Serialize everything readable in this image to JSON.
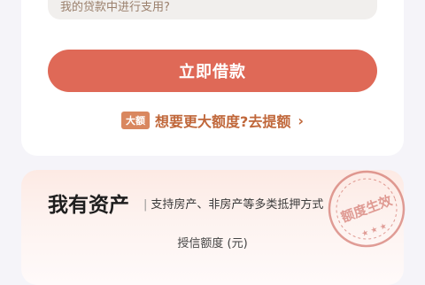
{
  "form": {
    "usage_placeholder": "我的贷款中进行支用?"
  },
  "actions": {
    "borrow_label": "立即借款"
  },
  "promo": {
    "badge": "大额",
    "text": "想要更大额度?去提额",
    "chevron": "›"
  },
  "assets": {
    "title": "我有资产",
    "separator": "|",
    "subtitle": "支持房产、非房产等多类抵押方式",
    "limit_label": "授信额度 (元)",
    "stamp_text": "额度生效"
  },
  "colors": {
    "primary": "#df6957",
    "promo": "#c0673a",
    "stamp": "#c8544a"
  }
}
